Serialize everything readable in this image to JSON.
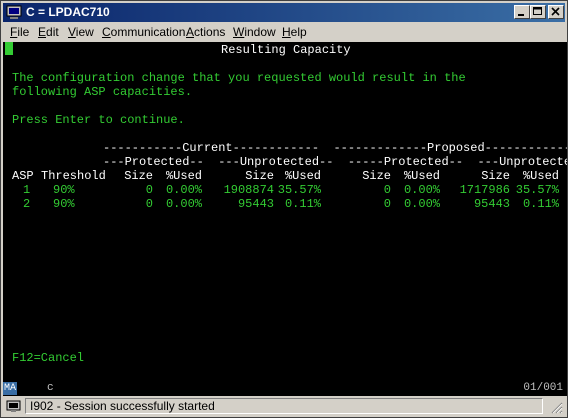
{
  "window": {
    "title": "C = LPDAC710"
  },
  "menu": [
    {
      "u": "F",
      "rest": "ile"
    },
    {
      "u": "E",
      "rest": "dit"
    },
    {
      "u": "V",
      "rest": "iew"
    },
    {
      "u": "C",
      "rest": "ommunication"
    },
    {
      "u": "A",
      "rest": "ctions"
    },
    {
      "u": "W",
      "rest": "indow"
    },
    {
      "u": "H",
      "rest": "elp"
    }
  ],
  "screen": {
    "heading": "Resulting Capacity",
    "message_line1": "The configuration change that you requested would result in the",
    "message_line2": "following ASP capacities.",
    "prompt": "Press Enter to continue.",
    "group_header": "-----------Current------------  -------------Proposed------------",
    "sub_header": "---Protected--  ---Unprotected--  -----Protected--  ---Unprotected--",
    "columns": [
      "ASP",
      "Threshold",
      "Size",
      "%Used",
      "Size",
      "%Used",
      "Size",
      "%Used",
      "Size",
      "%Used"
    ],
    "rows": [
      [
        "1",
        "90%",
        "0",
        "0.00%",
        "1908874",
        "35.57%",
        "0",
        "0.00%",
        "1717986",
        "35.57%"
      ],
      [
        "2",
        "90%",
        "0",
        "0.00%",
        "95443",
        "0.11%",
        "0",
        "0.00%",
        "95443",
        "0.11%"
      ]
    ],
    "function_keys": "F12=Cancel"
  },
  "oia": {
    "mode": "MA",
    "indicator": "c",
    "position": "01/001"
  },
  "status": {
    "text": "I902 - Session successfully started"
  },
  "colors": {
    "terminal_bg": "#000000",
    "terminal_green": "#33cc33",
    "terminal_white": "#ffffff",
    "titlebar_start": "#0a246a",
    "titlebar_end": "#3a6ea5"
  }
}
